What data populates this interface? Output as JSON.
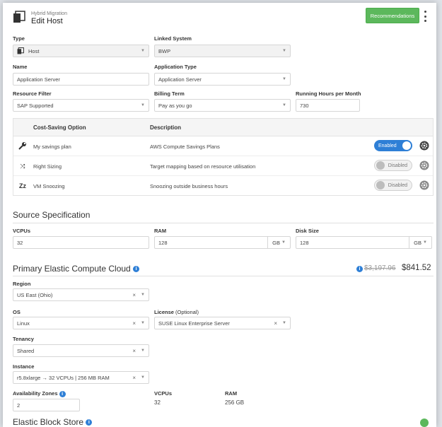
{
  "header": {
    "subtitle": "Hybrid Migration",
    "title": "Edit Host",
    "recommendations_label": "Recommendations"
  },
  "form": {
    "type": {
      "label": "Type",
      "value": "Host"
    },
    "linked_system": {
      "label": "Linked System",
      "value": "BWP"
    },
    "name": {
      "label": "Name",
      "value": "Application Server"
    },
    "application_type": {
      "label": "Application Type",
      "value": "Application Server"
    },
    "resource_filter": {
      "label": "Resource Filter",
      "value": "SAP Supported"
    },
    "billing_term": {
      "label": "Billing Term",
      "value": "Pay as you go"
    },
    "running_hours": {
      "label": "Running Hours per Month",
      "value": "730"
    }
  },
  "cost_saving": {
    "headers": {
      "option": "Cost-Saving Option",
      "description": "Description"
    },
    "rows": [
      {
        "icon": "wrench-icon",
        "name": "My savings plan",
        "description": "AWS Compute Savings Plans",
        "status": "Enabled"
      },
      {
        "icon": "resize-icon",
        "name": "Right Sizing",
        "description": "Target mapping based on resource utilisation",
        "status": "Disabled"
      },
      {
        "icon": "sleep-icon",
        "name": "VM Snoozing",
        "description": "Snoozing outside business hours",
        "status": "Disabled"
      }
    ]
  },
  "source_spec": {
    "title": "Source Specification",
    "vcpus": {
      "label": "VCPUs",
      "value": "32"
    },
    "ram": {
      "label": "RAM",
      "value": "128",
      "unit": "GB"
    },
    "disk": {
      "label": "Disk Size",
      "value": "128",
      "unit": "GB"
    }
  },
  "primary": {
    "title": "Primary Elastic Compute Cloud",
    "old_price": "$3,197.96",
    "new_price": "$841.52",
    "region": {
      "label": "Region",
      "value": "US East (Ohio)"
    },
    "os": {
      "label": "OS",
      "value": "Linux"
    },
    "license": {
      "label": "License",
      "label_optional": "(Optional)",
      "value": "SUSE Linux Enterprise Server"
    },
    "tenancy": {
      "label": "Tenancy",
      "value": "Shared"
    },
    "instance": {
      "label": "Instance",
      "value": "r5.8xlarge → 32 VCPUs | 256 MB RAM"
    },
    "availability_zones": {
      "label": "Availability Zones",
      "value": "2"
    },
    "vcpus": {
      "label": "VCPUs",
      "value": "32"
    },
    "ram": {
      "label": "RAM",
      "value": "256 GB"
    }
  },
  "next_section": {
    "title": "Elastic Block Store"
  },
  "colors": {
    "accent": "#2e7fd6",
    "green": "#5cb85c"
  }
}
